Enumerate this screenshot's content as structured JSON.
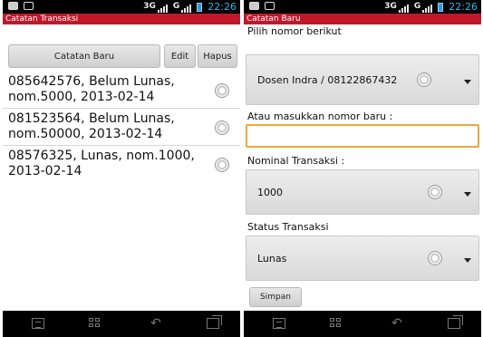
{
  "status_bar": {
    "network1": "3G",
    "network2": "G",
    "time": "22:26"
  },
  "list_screen": {
    "title": "Catatan Transaksi",
    "buttons": {
      "new": "Catatan Baru",
      "edit": "Edit",
      "delete": "Hapus"
    },
    "items": [
      {
        "text": "085642576, Belum Lunas, nom.5000, 2013-02-14"
      },
      {
        "text": "081523564, Belum Lunas, nom.50000, 2013-02-14"
      },
      {
        "text": "08576325, Lunas, nom.1000, 2013-02-14"
      }
    ]
  },
  "form_screen": {
    "title": "Catatan Baru",
    "choose_label": "Pilih nomor berikut",
    "contact_selected": "Dosen Indra / 08122867432",
    "new_number_label": "Atau masukkan nomor baru :",
    "new_number_value": "",
    "nominal_label": "Nominal Transaksi :",
    "nominal_selected": "1000",
    "status_label": "Status Transaksi",
    "status_selected": "Lunas",
    "save": "Simpan"
  },
  "colors": {
    "title_bar": "#c0182a",
    "focus_border": "#f3a53b",
    "clock": "#33b5e5"
  }
}
